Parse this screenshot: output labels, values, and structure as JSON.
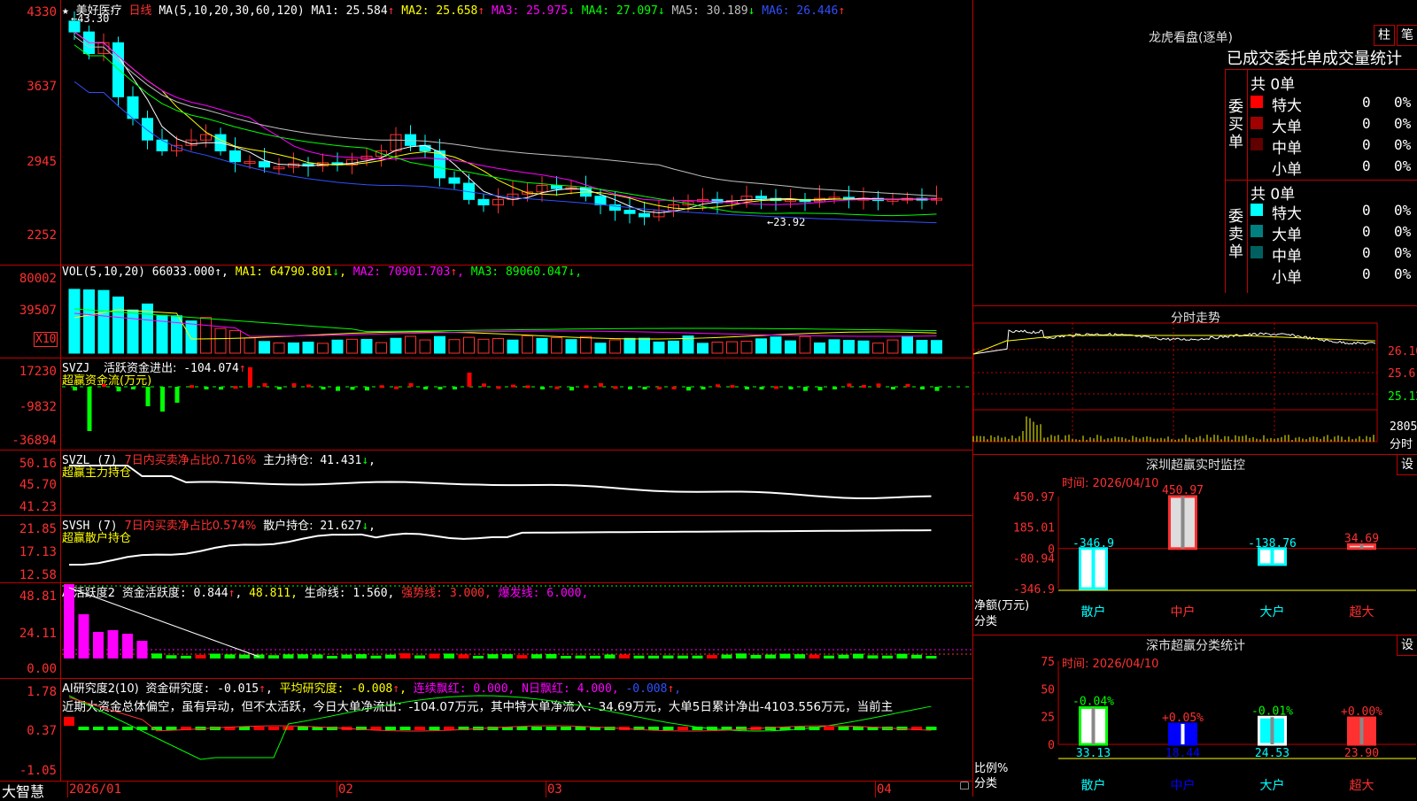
{
  "stock": {
    "name": "美好医疗",
    "period": "日线"
  },
  "price_panel": {
    "y_ticks": [
      "4330",
      "3637",
      "2945",
      "2252"
    ],
    "ma_label": "MA(5,10,20,30,60,120)",
    "ma": [
      {
        "label": "MA1:",
        "value": "25.584",
        "arrow": "↑",
        "color": "#ffffff"
      },
      {
        "label": "MA2:",
        "value": "25.658",
        "arrow": "↑",
        "color": "#ffff00"
      },
      {
        "label": "MA3:",
        "value": "25.975",
        "arrow": "↓",
        "color": "#ff00ff"
      },
      {
        "label": "MA4:",
        "value": "27.097",
        "arrow": "↓",
        "color": "#00ff00"
      },
      {
        "label": "MA5:",
        "value": "30.189",
        "arrow": "↓",
        "color": "#c0c0c0"
      },
      {
        "label": "MA6:",
        "value": "26.446",
        "arrow": "↑",
        "color": "#3050ff"
      }
    ],
    "high_label": "43.30",
    "low_label": "23.92"
  },
  "volume_panel": {
    "y_ticks": [
      "80002",
      "39507"
    ],
    "unit": "X10",
    "label": "VOL(5,10,20)",
    "value": "66033.000",
    "arrow": "↑",
    "ma": [
      {
        "label": "MA1:",
        "value": "64790.801",
        "arrow": "↓",
        "color": "#ffff00"
      },
      {
        "label": "MA2:",
        "value": "70901.703",
        "arrow": "↑",
        "color": "#ff00ff"
      },
      {
        "label": "MA3:",
        "value": "89060.047",
        "arrow": "↓",
        "color": "#00ff00"
      }
    ]
  },
  "svzj_panel": {
    "y_ticks": [
      "17230",
      "-9832",
      "-36894"
    ],
    "label": "SVZJ",
    "item": "活跃资金进出:",
    "value": "-104.074",
    "arrow": "↑",
    "subtitle": "超赢资金流(万元)"
  },
  "svzl_panel": {
    "y_ticks": [
      "50.16",
      "45.70",
      "41.23"
    ],
    "label": "SVZL (7)",
    "item": "7日内买卖净占比0.716%",
    "item2": "主力持仓:",
    "value": "41.431",
    "arrow": "↓",
    "subtitle": "超赢主力持仓"
  },
  "svsh_panel": {
    "y_ticks": [
      "21.85",
      "17.13",
      "12.58"
    ],
    "label": "SVSH (7)",
    "item": "7日内买卖净占比0.574%",
    "item2": "散户持仓:",
    "value": "21.627",
    "arrow": "↓",
    "subtitle": "超赢散户持仓"
  },
  "ai1_panel": {
    "y_ticks": [
      "48.81",
      "24.11",
      "0.00"
    ],
    "label": "AI活跃度2",
    "items": [
      {
        "text": "资金活跃度: 0.844",
        "arrow": "↑",
        "color": "#ffffff"
      },
      {
        "text": "48.811",
        "arrow": "",
        "color": "#ffff00"
      },
      {
        "text": "生命线: 1.560",
        "arrow": "",
        "color": "#ffffff"
      },
      {
        "text": "强势线: 3.000",
        "arrow": "",
        "color": "#ff3030"
      },
      {
        "text": "爆发线: 6.000",
        "arrow": "",
        "color": "#ff00ff"
      }
    ]
  },
  "ai2_panel": {
    "y_ticks": [
      "1.78",
      "0.37",
      "-1.05"
    ],
    "label": "AI研究度2(10)",
    "items": [
      {
        "text": "资金研究度: -0.015",
        "arrow": "↑",
        "color": "#ffffff"
      },
      {
        "text": "平均研究度: -0.008",
        "arrow": "↑",
        "color": "#ffff00"
      },
      {
        "text": "连续飘红: 0.000",
        "arrow": "",
        "color": "#ff00ff"
      },
      {
        "text": "N日飘红: 4.000",
        "arrow": "",
        "color": "#ff00ff"
      },
      {
        "text": "-0.008",
        "arrow": "↑",
        "color": "#3050ff"
      }
    ],
    "comment": "近期大资金总体偏空，虽有异动，但不太活跃，今日大单净流出：-104.07万元，其中特大单净流入：34.69万元，大单5日累计净出-4103.556万元，当前主"
  },
  "date_axis": {
    "brand": "大智慧",
    "labels": [
      "2026/01",
      "02",
      "03",
      "04"
    ]
  },
  "dragon_tiger": {
    "title": "龙虎看盘(逐单)",
    "btn1": "柱",
    "btn2": "笔",
    "header": "已成交委托单成交量统计",
    "buy_side": "委买单",
    "sell_side": "委卖单",
    "buy_total": "共 0单",
    "sell_total": "共 0单",
    "buy_rows": [
      {
        "label": "特大",
        "count": "0",
        "pct": "0%",
        "color": "#ff0000"
      },
      {
        "label": "大单",
        "count": "0",
        "pct": "0%",
        "color": "#a00000"
      },
      {
        "label": "中单",
        "count": "0",
        "pct": "0%",
        "color": "#600000"
      },
      {
        "label": "小单",
        "count": "0",
        "pct": "0%",
        "color": "#000000"
      }
    ],
    "sell_rows": [
      {
        "label": "特大",
        "count": "0",
        "pct": "0%",
        "color": "#00ffff"
      },
      {
        "label": "大单",
        "count": "0",
        "pct": "0%",
        "color": "#008080"
      },
      {
        "label": "中单",
        "count": "0",
        "pct": "0%",
        "color": "#006060"
      },
      {
        "label": "小单",
        "count": "0",
        "pct": "0%",
        "color": "#000000"
      }
    ]
  },
  "intraday": {
    "title": "分时走势",
    "price_ticks": [
      "26.10",
      "25.61",
      "25.12"
    ],
    "volume_tick": "2805",
    "volume_unit": "分时"
  },
  "sz_monitor": {
    "title": "深圳超赢实时监控",
    "btn": "设",
    "time": "时间: 2026/04/10",
    "y_ticks": [
      "450.97",
      "185.01",
      "0",
      "-80.94",
      "-346.9"
    ],
    "ylabel": "净额(万元)",
    "xlabel": "分类",
    "colors": {
      "up": "#ffffff",
      "down": "#00ffff"
    }
  },
  "sz_classify": {
    "title": "深市超赢分类统计",
    "btn": "设",
    "time": "时间: 2026/04/10",
    "y_ticks": [
      "75",
      "50",
      "25",
      "0"
    ],
    "ylabel": "比例%",
    "xlabel": "分类"
  },
  "chart_data": [
    {
      "type": "bar",
      "title": "深圳超赢实时监控",
      "ylabel": "净额(万元)",
      "xlabel": "分类",
      "categories": [
        "散户",
        "中户",
        "大户",
        "超大"
      ],
      "values": [
        -346.9,
        450.97,
        -138.76,
        34.69
      ],
      "labels": [
        "-346.9",
        "450.97",
        "-138.76",
        "34.69"
      ],
      "ylim": [
        -346.9,
        450.97
      ]
    },
    {
      "type": "bar",
      "title": "深市超赢分类统计",
      "ylabel": "比例%",
      "xlabel": "分类",
      "categories": [
        "散户",
        "中户",
        "大户",
        "超大"
      ],
      "values": [
        33.13,
        18.44,
        24.53,
        23.9
      ],
      "labels": [
        "33.13",
        "18.44",
        "24.53",
        "23.90"
      ],
      "changes": [
        "-0.04%",
        "+0.05%",
        "-0.01%",
        "+0.00%"
      ],
      "ylim": [
        0,
        75
      ]
    }
  ]
}
